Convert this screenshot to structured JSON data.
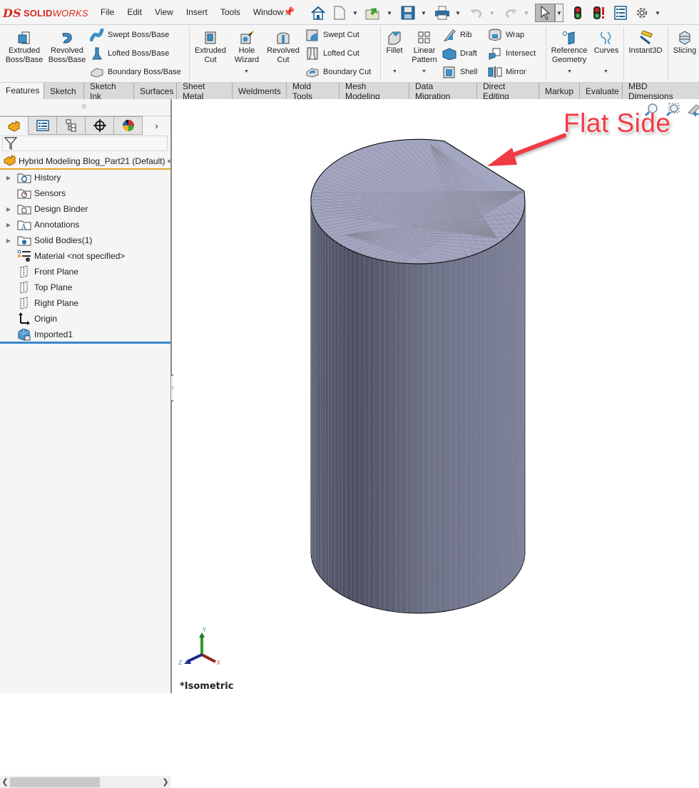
{
  "app": {
    "brand_bold": "SOLID",
    "brand_light": "WORKS",
    "brand_mark": "DS"
  },
  "menu": [
    "File",
    "Edit",
    "View",
    "Insert",
    "Tools",
    "Window"
  ],
  "quick_access": [
    {
      "icon": "home-icon"
    },
    {
      "icon": "new-document-icon",
      "dropdown": true
    },
    {
      "icon": "open-icon",
      "dropdown": true
    },
    {
      "icon": "save-icon",
      "dropdown": true
    },
    {
      "icon": "print-icon",
      "dropdown": true
    },
    {
      "icon": "undo-icon",
      "dropdown": true,
      "disabled": true
    },
    {
      "icon": "redo-icon",
      "dropdown": true,
      "disabled": true
    },
    {
      "icon": "select-cursor-icon",
      "dropdown": true,
      "active": true
    },
    {
      "icon": "rebuild-icon"
    },
    {
      "icon": "rebuild-all-icon"
    },
    {
      "icon": "file-properties-icon"
    },
    {
      "icon": "options-gear-icon",
      "dropdown": true
    }
  ],
  "ribbon": {
    "extruded_boss": "Extruded\nBoss/Base",
    "revolved_boss": "Revolved\nBoss/Base",
    "swept_boss": "Swept Boss/Base",
    "lofted_boss": "Lofted Boss/Base",
    "boundary_boss": "Boundary Boss/Base",
    "extruded_cut": "Extruded\nCut",
    "hole_wizard": "Hole\nWizard",
    "revolved_cut": "Revolved\nCut",
    "swept_cut": "Swept Cut",
    "lofted_cut": "Lofted Cut",
    "boundary_cut": "Boundary Cut",
    "fillet": "Fillet",
    "linear_pattern": "Linear\nPattern",
    "rib": "Rib",
    "draft": "Draft",
    "shell": "Shell",
    "wrap": "Wrap",
    "intersect": "Intersect",
    "mirror": "Mirror",
    "reference_geometry": "Reference\nGeometry",
    "curves": "Curves",
    "instant3d": "Instant3D",
    "slicing": "Slicing"
  },
  "tabs": [
    "Features",
    "Sketch",
    "Sketch Ink",
    "Surfaces",
    "Sheet Metal",
    "Weldments",
    "Mold Tools",
    "Mesh Modeling",
    "Data Migration",
    "Direct Editing",
    "Markup",
    "Evaluate",
    "MBD Dimensions"
  ],
  "active_tab": "Features",
  "panel": {
    "tabs": [
      "feature-manager",
      "property-manager",
      "configuration-manager",
      "dimxpert-manager",
      "display-manager"
    ],
    "more": "›",
    "root_label": "Hybrid Modeling Blog_Part21 (Default) <",
    "tree": [
      {
        "label": "History",
        "icon": "history-folder-icon",
        "expandable": true
      },
      {
        "label": "Sensors",
        "icon": "sensors-folder-icon",
        "expandable": false
      },
      {
        "label": "Design Binder",
        "icon": "design-binder-icon",
        "expandable": true
      },
      {
        "label": "Annotations",
        "icon": "annotations-folder-icon",
        "expandable": true
      },
      {
        "label": "Solid Bodies(1)",
        "icon": "solid-bodies-folder-icon",
        "expandable": true
      },
      {
        "label": "Material <not specified>",
        "icon": "material-icon",
        "expandable": false
      },
      {
        "label": "Front Plane",
        "icon": "plane-icon",
        "expandable": false
      },
      {
        "label": "Top Plane",
        "icon": "plane-icon",
        "expandable": false
      },
      {
        "label": "Right Plane",
        "icon": "plane-icon",
        "expandable": false
      },
      {
        "label": "Origin",
        "icon": "origin-icon",
        "expandable": false
      },
      {
        "label": "Imported1",
        "icon": "imported-body-icon",
        "expandable": false
      }
    ]
  },
  "viewport": {
    "annotation": "Flat Side",
    "view_label": "*Isometric",
    "triad": {
      "x": "X",
      "y": "Y",
      "z": "Z"
    },
    "colors": {
      "annotation": "#f03b45",
      "model_top": "#a3a6c0",
      "model_side": "#6f7389"
    }
  }
}
